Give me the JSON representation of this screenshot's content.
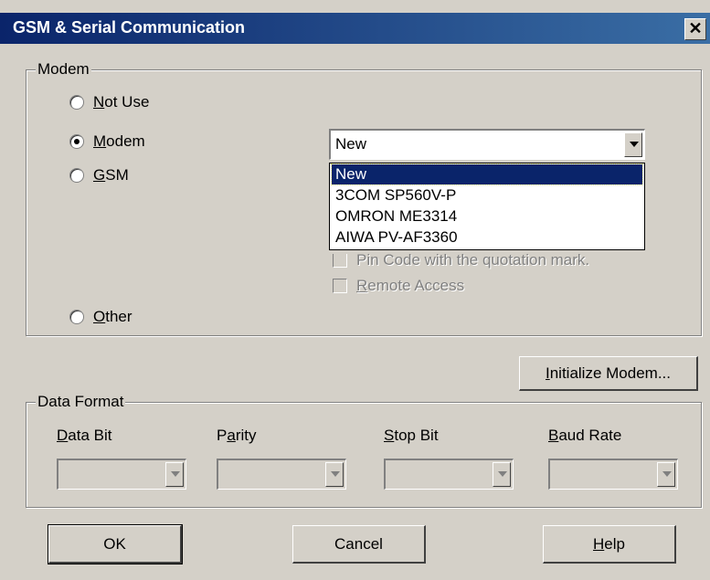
{
  "window": {
    "title": "GSM & Serial Communication",
    "close_glyph": "✕"
  },
  "modem_group": {
    "legend": "Modem",
    "options": [
      {
        "label": "Not Use",
        "mnemonic": "N",
        "rest": "ot Use",
        "selected": false
      },
      {
        "label": "Modem",
        "mnemonic": "M",
        "rest": "odem",
        "selected": true
      },
      {
        "label": "GSM",
        "mnemonic": "G",
        "rest": "SM",
        "selected": false
      },
      {
        "label": "Other",
        "mnemonic": "O",
        "rest": "ther",
        "selected": false
      }
    ],
    "modem_select": {
      "value": "New",
      "options": [
        "New",
        "3COM SP560V-P",
        "OMRON ME3314",
        "AIWA PV-AF3360"
      ],
      "highlighted": "New"
    },
    "pin_code_checkbox": "Pin Code with the quotation mark.",
    "remote_access_checkbox": {
      "mnemonic": "R",
      "rest": "emote Access"
    }
  },
  "initialize_button": {
    "mnemonic": "I",
    "rest": "nitialize Modem..."
  },
  "data_format_group": {
    "legend": "Data Format",
    "fields": [
      {
        "mnemonic": "D",
        "rest": "ata Bit"
      },
      {
        "pre": "P",
        "mnemonic": "a",
        "rest": "rity"
      },
      {
        "mnemonic": "S",
        "rest": "top Bit"
      },
      {
        "mnemonic": "B",
        "rest": "aud Rate"
      }
    ]
  },
  "buttons": {
    "ok": "OK",
    "cancel": "Cancel",
    "help": {
      "mnemonic": "H",
      "rest": "elp"
    }
  },
  "colors": {
    "titlebar_start": "#0a246a",
    "titlebar_end": "#3a6ea5",
    "dialog_bg": "#d4d0c8",
    "selection": "#0a246a"
  }
}
